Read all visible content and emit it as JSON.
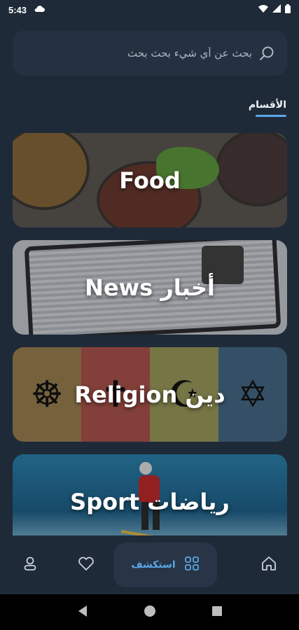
{
  "status_bar": {
    "time": "5:43"
  },
  "search": {
    "placeholder": "بحث عن أي شيء بحث بحث"
  },
  "section": {
    "label": "الأقسام"
  },
  "categories": [
    {
      "title": "Food"
    },
    {
      "title": "News أخبار"
    },
    {
      "title": "Religion دين"
    },
    {
      "title": "Sport رياضات"
    }
  ],
  "bottom_nav": {
    "explore_label": "استكشف"
  },
  "colors": {
    "background": "#1f2a38",
    "surface": "#243141",
    "accent": "#5ba7e6"
  }
}
